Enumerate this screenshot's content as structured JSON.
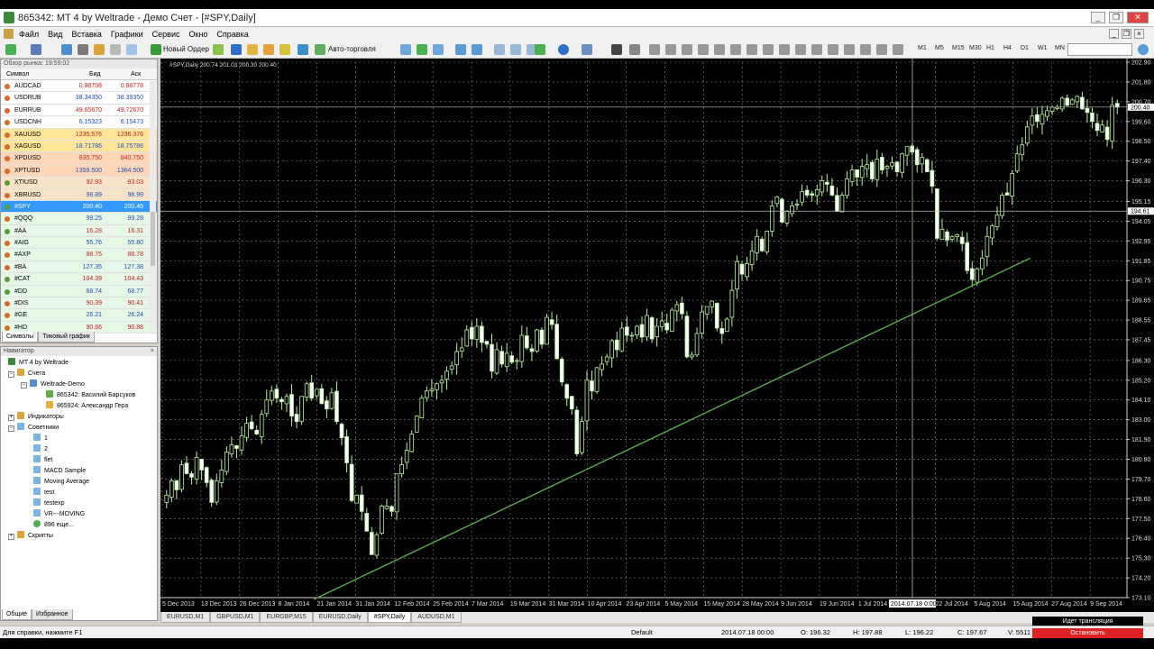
{
  "window": {
    "title": "865342: MT 4 by Weltrade - Демо Счет - [#SPY,Daily]"
  },
  "menu": [
    "Файл",
    "Вид",
    "Вставка",
    "Графики",
    "Сервис",
    "Окно",
    "Справка"
  ],
  "toolbar": {
    "new_order": "Новый Ордер",
    "autotrade": "Авто-торговля",
    "timeframes": [
      "M1",
      "M5",
      "M15",
      "M30",
      "H1",
      "H4",
      "D1",
      "W1",
      "MN"
    ]
  },
  "market_watch": {
    "header": "Обзор рынка: 19:59:02",
    "col_symbol": "Символ",
    "col_bid": "Бид",
    "col_ask": "Аск",
    "rows": [
      {
        "sym": "AUDCAD",
        "bid": "0.98708",
        "ask": "0.98778",
        "bg": "#ffffff",
        "dot": "#d66a2c"
      },
      {
        "sym": "USDRUB",
        "bid": "38.34350",
        "ask": "38.39350",
        "bg": "#ffffff",
        "dot": "#d66a2c"
      },
      {
        "sym": "EURRUB",
        "bid": "49.65670",
        "ask": "49.72670",
        "bg": "#ffffff",
        "dot": "#d66a2c"
      },
      {
        "sym": "USDCNH",
        "bid": "6.15323",
        "ask": "6.15473",
        "bg": "#ffffff",
        "dot": "#d66a2c"
      },
      {
        "sym": "XAUUSD",
        "bid": "1235.576",
        "ask": "1236.376",
        "bg": "#ffe59a",
        "dot": "#d66a2c"
      },
      {
        "sym": "XAGUSD",
        "bid": "18.71786",
        "ask": "18.75786",
        "bg": "#ffe59a",
        "dot": "#d66a2c"
      },
      {
        "sym": "XPDUSD",
        "bid": "835.750",
        "ask": "840.750",
        "bg": "#ffd7b8",
        "dot": "#d66a2c"
      },
      {
        "sym": "XPTUSD",
        "bid": "1359.500",
        "ask": "1364.500",
        "bg": "#ffd7b8",
        "dot": "#d66a2c"
      },
      {
        "sym": "XTIUSD",
        "bid": "92.93",
        "ask": "93.03",
        "bg": "#f7e4c8",
        "dot": "#5a9a3a"
      },
      {
        "sym": "XBRUSD",
        "bid": "98.89",
        "ask": "98.99",
        "bg": "#f7e4c8",
        "dot": "#d66a2c"
      },
      {
        "sym": "#SPY",
        "bid": "200.40",
        "ask": "200.45",
        "bg": "#3399ff",
        "dot": "#5a9a3a",
        "sel": true
      },
      {
        "sym": "#QQQ",
        "bid": "99.25",
        "ask": "99.28",
        "bg": "#e6f7e6",
        "dot": "#d66a2c"
      },
      {
        "sym": "#AA",
        "bid": "16.28",
        "ask": "16.31",
        "bg": "#e6f7e6",
        "dot": "#5a9a3a"
      },
      {
        "sym": "#AIG",
        "bid": "55.76",
        "ask": "55.80",
        "bg": "#e6f7e6",
        "dot": "#d66a2c"
      },
      {
        "sym": "#AXP",
        "bid": "88.75",
        "ask": "88.78",
        "bg": "#e6f7e6",
        "dot": "#d66a2c"
      },
      {
        "sym": "#BA",
        "bid": "127.35",
        "ask": "127.38",
        "bg": "#e6f7e6",
        "dot": "#d66a2c"
      },
      {
        "sym": "#CAT",
        "bid": "104.39",
        "ask": "104.43",
        "bg": "#e6f7e6",
        "dot": "#5a9a3a"
      },
      {
        "sym": "#DD",
        "bid": "68.74",
        "ask": "68.77",
        "bg": "#e6f7e6",
        "dot": "#5a9a3a"
      },
      {
        "sym": "#DIS",
        "bid": "90.39",
        "ask": "90.41",
        "bg": "#e6f7e6",
        "dot": "#d66a2c"
      },
      {
        "sym": "#GE",
        "bid": "26.21",
        "ask": "26.24",
        "bg": "#e6f7e6",
        "dot": "#d66a2c"
      },
      {
        "sym": "#HD",
        "bid": "90.86",
        "ask": "90.88",
        "bg": "#e6f7e6",
        "dot": "#d66a2c"
      }
    ],
    "tab_symbols": "Символы",
    "tab_tick": "Тиковый график"
  },
  "navigator": {
    "header": "Навигатор",
    "root": "MT 4 by Weltrade",
    "accounts": "Счета",
    "server": "Weltrade-Demo",
    "acc1": "865342: Василий Барсуков",
    "acc2": "865924: Александр Гера",
    "indicators": "Индикаторы",
    "advisors": "Советники",
    "experts": [
      "1",
      "2",
      "flet",
      "MACD Sample",
      "Moving Average",
      "test",
      "testexp",
      "VR---MOVING"
    ],
    "more": "896 еще...",
    "scripts": "Скрипты",
    "tab_common": "Общие",
    "tab_fav": "Избранное"
  },
  "chart": {
    "info": "#SPY,Daily  200.74 201.03 200.30 200.40",
    "price_marker": "200.40",
    "cross_price": "194.61",
    "cross_date": "2014.07.18 0:00",
    "price_labels": [
      "202.90",
      "201.80",
      "200.70",
      "199.60",
      "198.50",
      "197.40",
      "196.30",
      "195.15",
      "194.05",
      "192.95",
      "191.85",
      "190.75",
      "189.65",
      "188.55",
      "187.45",
      "186.30",
      "185.20",
      "184.10",
      "183.00",
      "181.90",
      "180.80",
      "179.70",
      "178.60",
      "177.50",
      "176.40",
      "175.30",
      "174.20",
      "173.10"
    ],
    "date_labels": [
      "5 Dec 2013",
      "13 Dec 2013",
      "26 Dec 2013",
      "8 Jan 2014",
      "21 Jan 2014",
      "31 Jan 2014",
      "12 Feb 2014",
      "25 Feb 2014",
      "7 Mar 2014",
      "19 Mar 2014",
      "31 Mar 2014",
      "10 Apr 2014",
      "23 Apr 2014",
      "5 May 2014",
      "15 May 2014",
      "28 May 2014",
      "9 Jun 2014",
      "19 Jun 2014",
      "1 Jul 2014",
      "",
      "22 Jul 2014",
      "5 Aug 2014",
      "15 Aug 2014",
      "27 Aug 2014",
      "9 Sep 2014"
    ],
    "candles": [
      178.8,
      179.6,
      179.1,
      180.5,
      180.0,
      179.8,
      180.9,
      180.2,
      179.5,
      178.4,
      179.6,
      180.2,
      181.2,
      181.6,
      181.4,
      182.1,
      182.8,
      182.5,
      182.2,
      183.3,
      184.1,
      184.6,
      184.2,
      184.0,
      184.3,
      183.2,
      182.9,
      184.3,
      185.0,
      184.2,
      184.7,
      183.9,
      183.6,
      184.5,
      182.9,
      182.0,
      180.6,
      178.5,
      178.8,
      177.9,
      176.8,
      175.5,
      176.6,
      178.2,
      178.2,
      177.9,
      180.0,
      180.5,
      181.3,
      182.2,
      183.2,
      184.2,
      184.6,
      184.7,
      185.0,
      185.2,
      185.7,
      186.0,
      186.8,
      187.0,
      188.0,
      187.5,
      188.2,
      187.3,
      187.2,
      185.7,
      186.9,
      186.1,
      186.7,
      186.2,
      186.3,
      187.7,
      187.0,
      186.8,
      188.0,
      187.2,
      188.7,
      188.3,
      186.4,
      185.1,
      184.2,
      183.6,
      181.1,
      182.9,
      185.2,
      184.6,
      185.9,
      186.1,
      186.5,
      187.4,
      186.9,
      188.1,
      187.7,
      187.7,
      188.2,
      187.6,
      188.8,
      187.5,
      188.2,
      188.5,
      188.0,
      189.1,
      189.4,
      188.9,
      186.5,
      186.6,
      187.8,
      189.0,
      189.3,
      189.6,
      188.1,
      187.8,
      188.6,
      190.2,
      191.8,
      191.1,
      191.7,
      192.4,
      193.2,
      192.4,
      193.5,
      194.9,
      195.4,
      194.0,
      194.6,
      194.9,
      195.0,
      195.7,
      195.5,
      195.5,
      195.8,
      196.3,
      196.1,
      195.5,
      194.6,
      195.5,
      196.4,
      196.9,
      196.5,
      197.1,
      197.2,
      196.4,
      197.5,
      196.9,
      197.1,
      197.3,
      196.8,
      197.8,
      198.2,
      197.9,
      197.2,
      197.6,
      196.8,
      196.0,
      193.1,
      193.6,
      193.0,
      193.2,
      193.3,
      192.8,
      191.3,
      190.8,
      191.4,
      192.0,
      193.2,
      193.8,
      194.4,
      195.5,
      195.5,
      196.7,
      197.8,
      198.3,
      199.3,
      199.9,
      199.6,
      200.0,
      200.2,
      200.4,
      200.4,
      200.9,
      200.5,
      200.8,
      201.0,
      200.3,
      200.1,
      199.6,
      199.1,
      199.4,
      198.6,
      200.5,
      200.4
    ],
    "trend_from": 173.0,
    "trend_to": 192.0
  },
  "chart_tabs": [
    "EURUSD,M1",
    "GBPUSD,M1",
    "EURGBP,M15",
    "EURUSD,Daily",
    "#SPY,Daily",
    "AUDUSD,M1"
  ],
  "active_tab": "#SPY,Daily",
  "status": {
    "help": "Для справки, нажмите F1",
    "profile": "Default",
    "time": "2014.07.18 00:00",
    "o": "O: 196.32",
    "h": "H: 197.88",
    "l": "L: 196.22",
    "c": "C: 197.67",
    "v": "V: 5511",
    "broadcast": "Идет трансляция",
    "stop": "Остановить"
  }
}
